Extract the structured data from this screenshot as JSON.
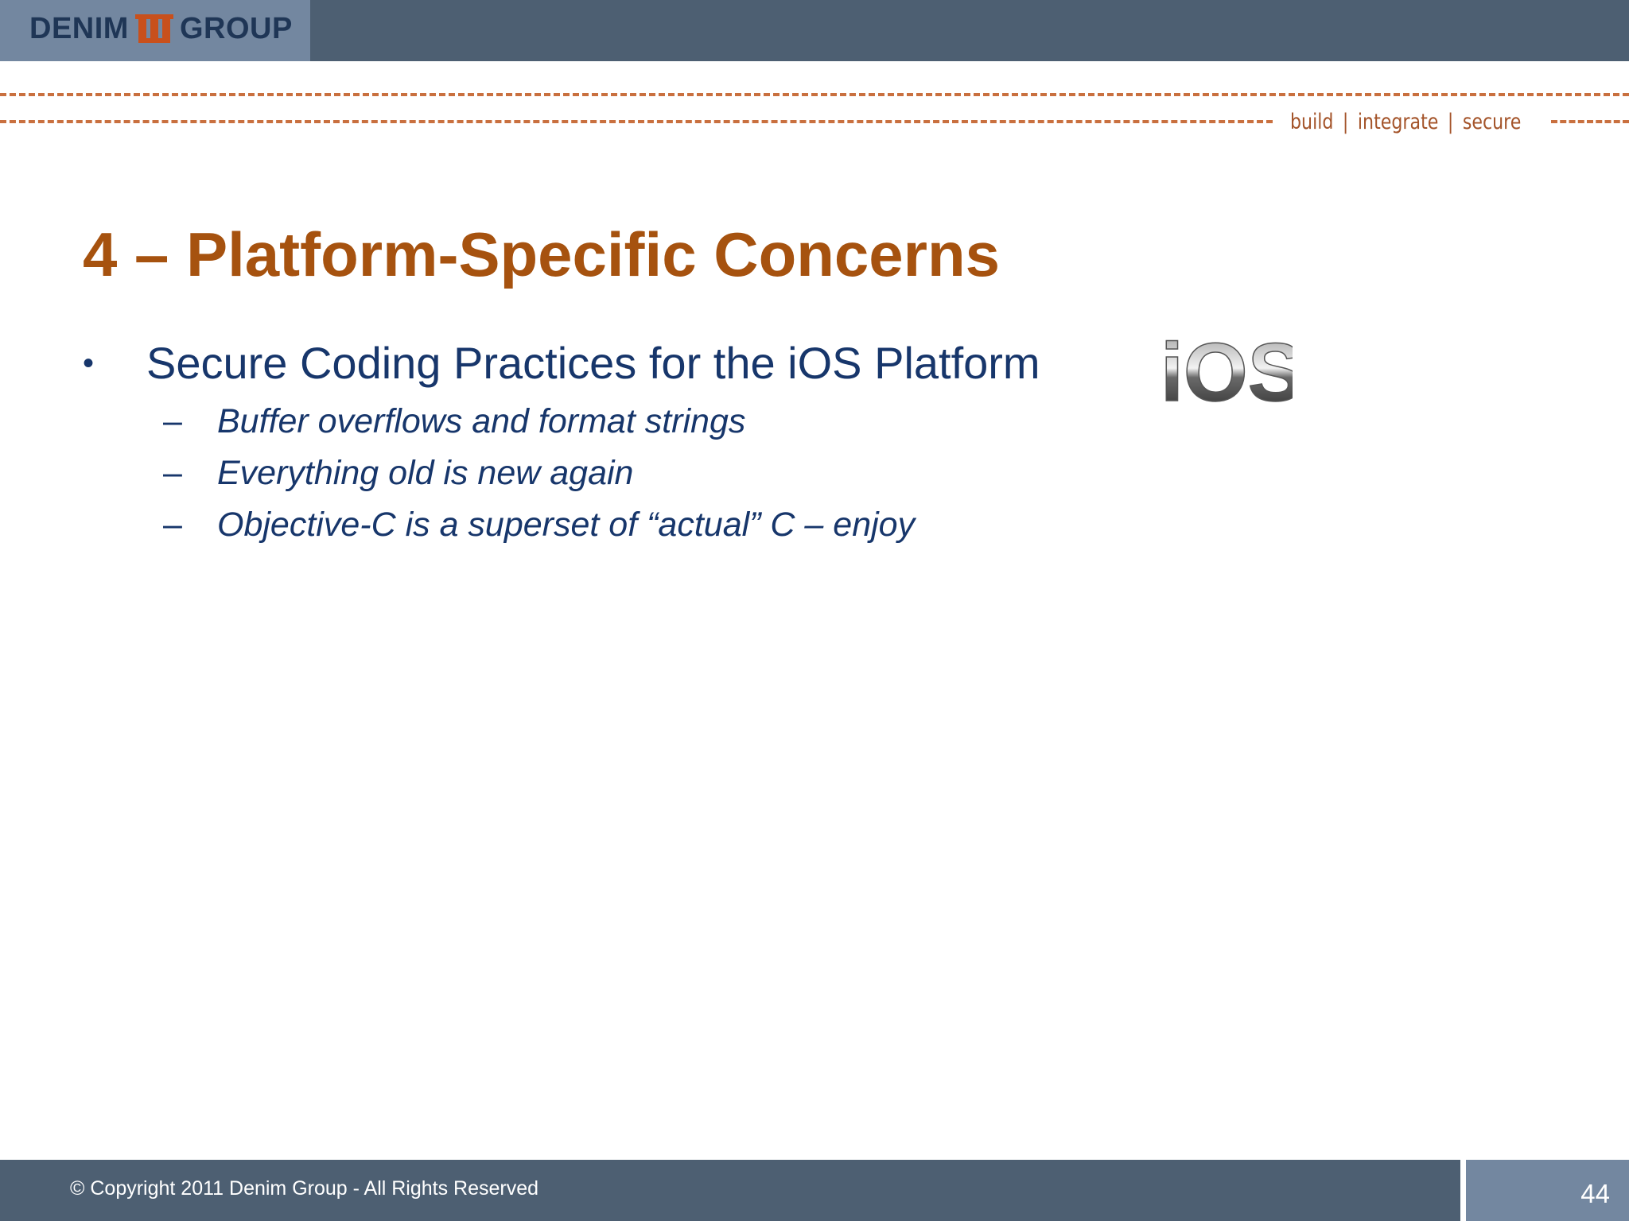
{
  "header": {
    "logo_left": "DENIM",
    "logo_right": "GROUP",
    "tagline": [
      "build",
      "integrate",
      "secure"
    ],
    "tagline_separator": "|"
  },
  "slide": {
    "title": "4 – Platform-Specific Concerns",
    "bullet_marker": "•",
    "bullet": "Secure Coding Practices for the iOS Platform",
    "sub_marker": "–",
    "sub_items": [
      "Buffer overflows and format strings",
      "Everything old is new again",
      "Objective-C is a superset of “actual” C – enjoy"
    ],
    "ios_logo_text": "iOS"
  },
  "footer": {
    "copyright": "© Copyright 2011 Denim Group - All Rights Reserved",
    "page_number": "44"
  },
  "colors": {
    "header_bar": "#4d5f72",
    "logo_box": "#7387a0",
    "title": "#a6520f",
    "body_text": "#17366b",
    "dash_accent": "#c9703f",
    "logo_mark": "#c8501c"
  }
}
